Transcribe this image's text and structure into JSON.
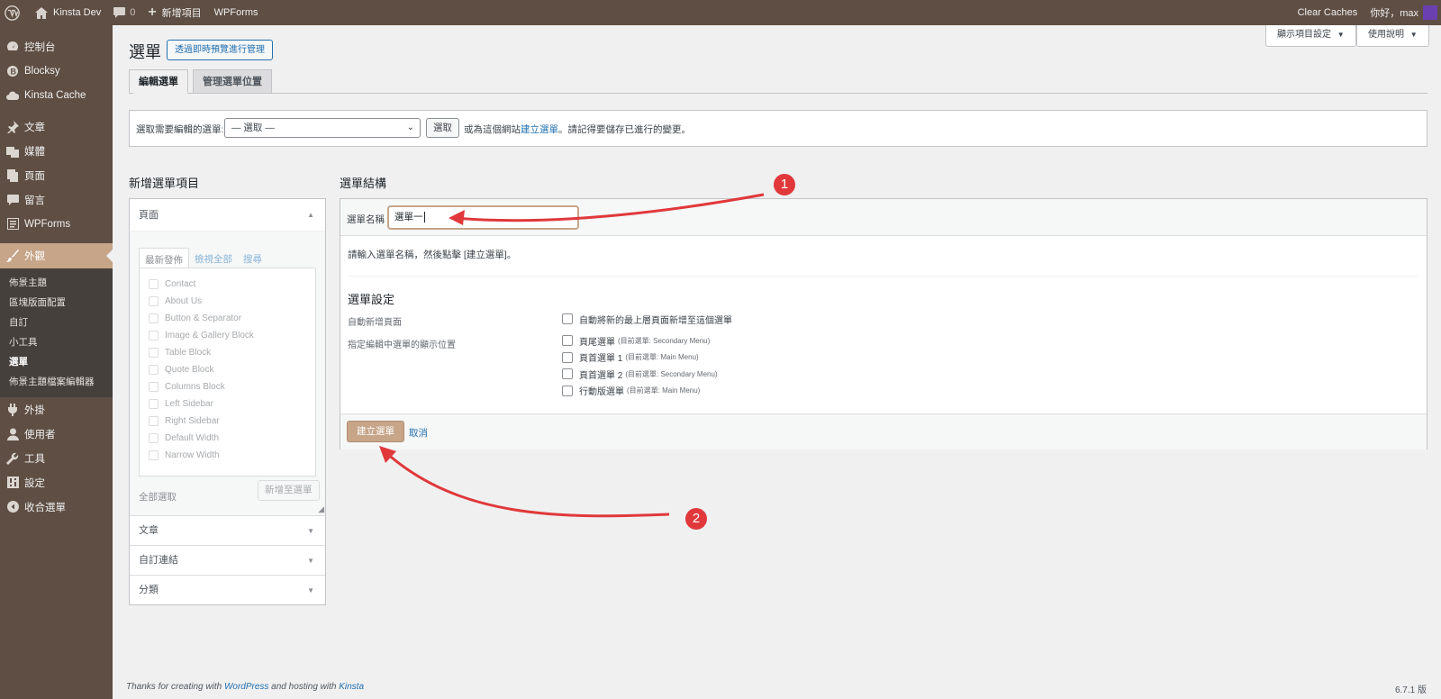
{
  "adminbar": {
    "site_name": "Kinsta Dev",
    "comments_count": "0",
    "new_label": "新增項目",
    "wpforms_label": "WPForms",
    "clear_caches": "Clear Caches",
    "greeting": "你好，max"
  },
  "sidebar": {
    "items": [
      {
        "label": "控制台",
        "icon": "dashboard-icon"
      },
      {
        "label": "Blocksy",
        "icon": "blocksy-icon"
      },
      {
        "label": "Kinsta Cache",
        "icon": "cloud-icon"
      },
      {
        "label": "文章",
        "icon": "pin-icon"
      },
      {
        "label": "媒體",
        "icon": "media-icon"
      },
      {
        "label": "頁面",
        "icon": "pages-icon"
      },
      {
        "label": "留言",
        "icon": "comments-icon"
      },
      {
        "label": "WPForms",
        "icon": "wpforms-icon"
      },
      {
        "label": "外觀",
        "icon": "brush-icon"
      },
      {
        "label": "外掛",
        "icon": "plugins-icon"
      },
      {
        "label": "使用者",
        "icon": "users-icon"
      },
      {
        "label": "工具",
        "icon": "tools-icon"
      },
      {
        "label": "設定",
        "icon": "settings-icon"
      },
      {
        "label": "收合選單",
        "icon": "collapse-icon"
      }
    ],
    "submenu": [
      "佈景主題",
      "區塊版面配置",
      "自訂",
      "小工具",
      "選單",
      "佈景主題檔案編輯器"
    ],
    "active_submenu": "選單"
  },
  "screen_options": {
    "display_options": "顯示項目設定",
    "help": "使用說明"
  },
  "header": {
    "title": "選單",
    "live_preview_button": "透過即時預覽進行管理"
  },
  "tabs": [
    "編輯選單",
    "管理選單位置"
  ],
  "selector": {
    "label": "選取需要編輯的選單:",
    "select_value": "— 選取 —",
    "select_button": "選取",
    "hint_prefix": "或為這個網站",
    "hint_link": "建立選單",
    "hint_suffix": "。請記得要儲存已進行的變更。"
  },
  "add_items": {
    "heading": "新增選單項目",
    "pages_section": "頁面",
    "inner_tabs": [
      "最新發佈",
      "檢視全部",
      "搜尋"
    ],
    "pages": [
      "Contact",
      "About Us",
      "Button & Separator",
      "Image & Gallery Block",
      "Table Block",
      "Quote Block",
      "Columns Block",
      "Left Sidebar",
      "Right Sidebar",
      "Default Width",
      "Narrow Width"
    ],
    "select_all": "全部選取",
    "add_to_menu": "新增至選單",
    "other_sections": [
      "文章",
      "自訂連結",
      "分類"
    ]
  },
  "structure": {
    "heading": "選單結構",
    "name_label": "選單名稱",
    "name_value": "選單一",
    "instruction": "請輸入選單名稱，然後點擊 [建立選單]。",
    "settings_heading": "選單設定",
    "auto_add_label": "自動新增頁面",
    "auto_add_option": "自動將新的最上層頁面新增至這個選單",
    "locations_label": "指定編輯中選單的顯示位置",
    "locations": [
      {
        "name": "頁尾選單",
        "current": "(目前選單: Secondary Menu)"
      },
      {
        "name": "頁首選單 1",
        "current": "(目前選單: Main Menu)"
      },
      {
        "name": "頁首選單 2",
        "current": "(目前選單: Secondary Menu)"
      },
      {
        "name": "行動版選單",
        "current": "(目前選單: Main Menu)"
      }
    ],
    "create_button": "建立選單",
    "cancel_link": "取消"
  },
  "annotations": {
    "badge1": "1",
    "badge2": "2",
    "arrow_color": "#e0383b"
  },
  "footer": {
    "thanks_prefix": "Thanks for creating with ",
    "wordpress_link": "WordPress",
    "middle": " and hosting with ",
    "kinsta_link": "Kinsta",
    "version": "6.7.1 版"
  },
  "colors": {
    "sidebar": "#5e4e43",
    "accent": "#c7a589",
    "link": "#2271b1"
  }
}
